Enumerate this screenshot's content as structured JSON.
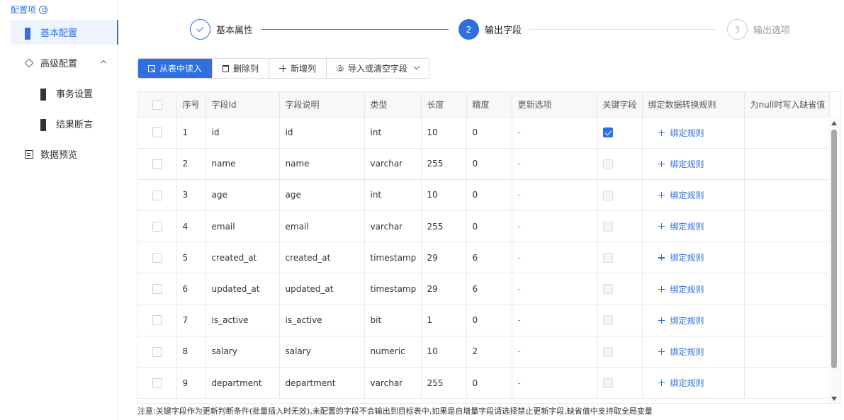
{
  "sidebar": {
    "title": "配置项",
    "items": [
      {
        "label": "基本配置"
      },
      {
        "label": "高级配置"
      },
      {
        "label": "事务设置"
      },
      {
        "label": "结果断言"
      },
      {
        "label": "数据预览"
      }
    ]
  },
  "steps": [
    {
      "label": "基本属性",
      "state": "done"
    },
    {
      "label": "输出字段",
      "number": "2",
      "state": "current"
    },
    {
      "label": "输出选项",
      "number": "3",
      "state": "todo"
    }
  ],
  "toolbar": {
    "read_label": "从表中读入",
    "delete_label": "删除列",
    "add_label": "新增列",
    "import_label": "导入或清空字段"
  },
  "table": {
    "headers": [
      "序号",
      "字段Id",
      "字段说明",
      "类型",
      "长度",
      "精度",
      "更新选项",
      "关键字段",
      "绑定数据转换规则",
      "为null时写入缺省值"
    ],
    "bind_label": "绑定规则",
    "rows": [
      {
        "no": "1",
        "id": "id",
        "desc": "id",
        "type": "int",
        "len": "10",
        "prec": "0",
        "upd": "-",
        "key": true
      },
      {
        "no": "2",
        "id": "name",
        "desc": "name",
        "type": "varchar",
        "len": "255",
        "prec": "0",
        "upd": "-",
        "key": false
      },
      {
        "no": "3",
        "id": "age",
        "desc": "age",
        "type": "int",
        "len": "10",
        "prec": "0",
        "upd": "-",
        "key": false
      },
      {
        "no": "4",
        "id": "email",
        "desc": "email",
        "type": "varchar",
        "len": "255",
        "prec": "0",
        "upd": "-",
        "key": false
      },
      {
        "no": "5",
        "id": "created_at",
        "desc": "created_at",
        "type": "timestamp",
        "len": "29",
        "prec": "6",
        "upd": "-",
        "key": false
      },
      {
        "no": "6",
        "id": "updated_at",
        "desc": "updated_at",
        "type": "timestamp",
        "len": "29",
        "prec": "6",
        "upd": "-",
        "key": false
      },
      {
        "no": "7",
        "id": "is_active",
        "desc": "is_active",
        "type": "bit",
        "len": "1",
        "prec": "0",
        "upd": "-",
        "key": false
      },
      {
        "no": "8",
        "id": "salary",
        "desc": "salary",
        "type": "numeric",
        "len": "10",
        "prec": "2",
        "upd": "-",
        "key": false
      },
      {
        "no": "9",
        "id": "department",
        "desc": "department",
        "type": "varchar",
        "len": "255",
        "prec": "0",
        "upd": "-",
        "key": false
      }
    ]
  },
  "note": "注意:关键字段作为更新判断条件(批量插入时无效),未配置的字段不会输出到目标表中,如果是自增量字段请选择禁止更新字段,缺省值中支持取全局变量",
  "colors": {
    "accent": "#2f6fe0",
    "border": "#e8e8e8"
  }
}
